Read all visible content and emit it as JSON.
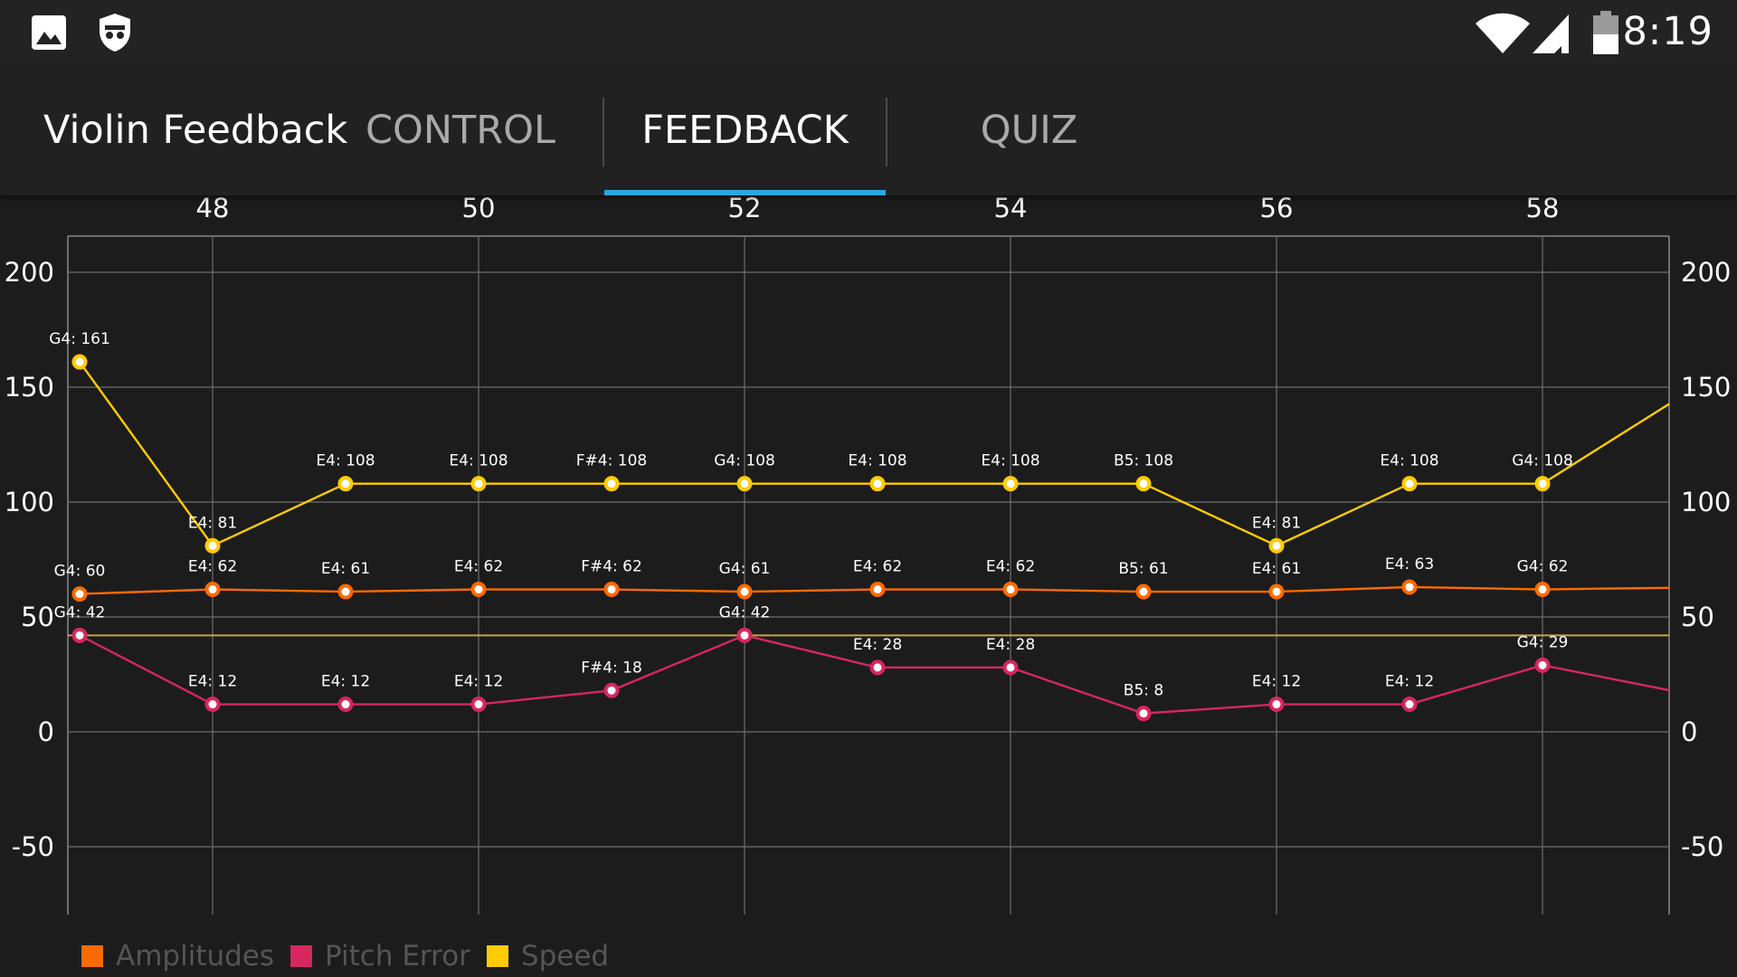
{
  "status_bar": {
    "time": "8:19",
    "left_icons": [
      "image-icon",
      "incognito-shield-icon"
    ],
    "right_icons": [
      "wifi-icon",
      "cell-signal-icon",
      "battery-icon"
    ]
  },
  "app_bar": {
    "title": "Violin Feedback",
    "tabs": [
      {
        "label": "CONTROL",
        "active": false
      },
      {
        "label": "FEEDBACK",
        "active": true
      },
      {
        "label": "QUIZ",
        "active": false
      }
    ],
    "indicator_color": "#2aa7de"
  },
  "chart_data": {
    "type": "line",
    "x_ticks": [
      "48",
      "50",
      "52",
      "54",
      "56",
      "58"
    ],
    "y_ticks": [
      "200",
      "150",
      "100",
      "50",
      "0",
      "-50"
    ],
    "xlim": [
      46.9,
      59.4
    ],
    "ylim": [
      -80,
      215
    ],
    "grid": true,
    "reference_line": 42,
    "legend_position": "bottom-left",
    "series": [
      {
        "name": "Amplitudes",
        "color": "#ff6a00",
        "points": [
          {
            "x": 47,
            "y": 60,
            "label": "G4: 60"
          },
          {
            "x": 48,
            "y": 62,
            "label": "E4: 62"
          },
          {
            "x": 49,
            "y": 61,
            "label": "E4: 61"
          },
          {
            "x": 50,
            "y": 62,
            "label": "E4: 62"
          },
          {
            "x": 51,
            "y": 62,
            "label": "F#4: 62"
          },
          {
            "x": 52,
            "y": 61,
            "label": "G4: 61"
          },
          {
            "x": 53,
            "y": 62,
            "label": "E4: 62"
          },
          {
            "x": 54,
            "y": 62,
            "label": "E4: 62"
          },
          {
            "x": 55,
            "y": 61,
            "label": "B5: 61"
          },
          {
            "x": 56,
            "y": 61,
            "label": "E4: 61"
          },
          {
            "x": 57,
            "y": 63,
            "label": "E4: 63"
          },
          {
            "x": 58,
            "y": 62,
            "label": "G4: 62"
          },
          {
            "x": 59.4,
            "y": 63,
            "label": ""
          }
        ]
      },
      {
        "name": "Pitch Error",
        "color": "#d6275e",
        "points": [
          {
            "x": 47,
            "y": 42,
            "label": "G4: 42"
          },
          {
            "x": 48,
            "y": 12,
            "label": "E4: 12"
          },
          {
            "x": 49,
            "y": 12,
            "label": "E4: 12"
          },
          {
            "x": 50,
            "y": 12,
            "label": "E4: 12"
          },
          {
            "x": 51,
            "y": 18,
            "label": "F#4: 18"
          },
          {
            "x": 52,
            "y": 42,
            "label": "G4: 42"
          },
          {
            "x": 53,
            "y": 28,
            "label": "E4: 28"
          },
          {
            "x": 54,
            "y": 28,
            "label": "E4: 28"
          },
          {
            "x": 55,
            "y": 8,
            "label": "B5: 8"
          },
          {
            "x": 56,
            "y": 12,
            "label": "E4: 12"
          },
          {
            "x": 57,
            "y": 12,
            "label": "E4: 12"
          },
          {
            "x": 58,
            "y": 29,
            "label": "G4: 29"
          },
          {
            "x": 59.4,
            "y": 13,
            "label": ""
          }
        ]
      },
      {
        "name": "Speed",
        "color": "#ffcc00",
        "points": [
          {
            "x": 47,
            "y": 161,
            "label": "G4: 161"
          },
          {
            "x": 48,
            "y": 81,
            "label": "E4: 81"
          },
          {
            "x": 49,
            "y": 108,
            "label": "E4: 108"
          },
          {
            "x": 50,
            "y": 108,
            "label": "E4: 108"
          },
          {
            "x": 51,
            "y": 108,
            "label": "F#4: 108"
          },
          {
            "x": 52,
            "y": 108,
            "label": "G4: 108"
          },
          {
            "x": 53,
            "y": 108,
            "label": "E4: 108"
          },
          {
            "x": 54,
            "y": 108,
            "label": "E4: 108"
          },
          {
            "x": 55,
            "y": 108,
            "label": "B5: 108"
          },
          {
            "x": 56,
            "y": 81,
            "label": "E4: 81"
          },
          {
            "x": 57,
            "y": 108,
            "label": "E4: 108"
          },
          {
            "x": 58,
            "y": 108,
            "label": "G4: 108"
          },
          {
            "x": 59.4,
            "y": 159,
            "label": ""
          }
        ]
      }
    ]
  }
}
